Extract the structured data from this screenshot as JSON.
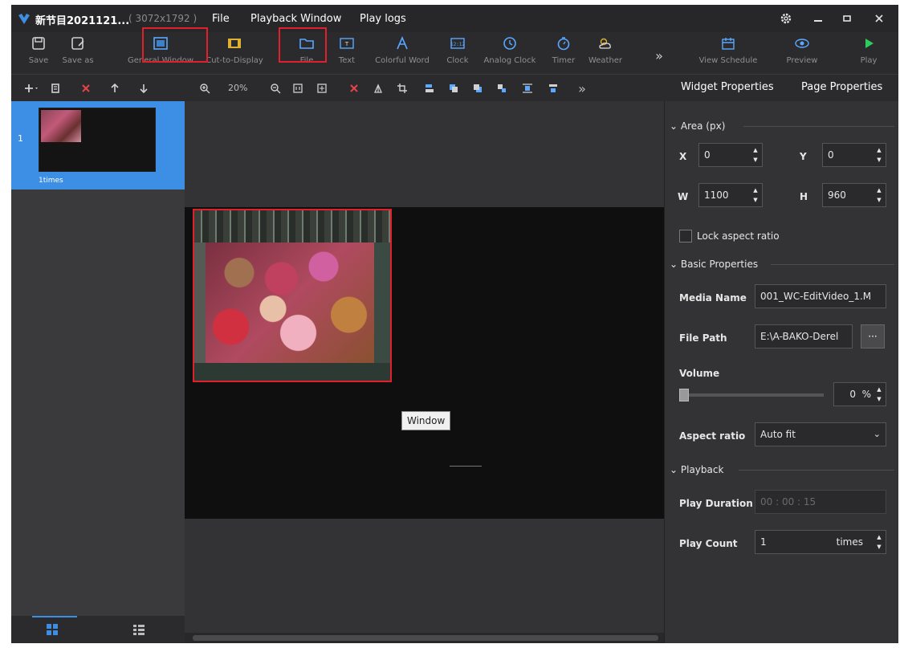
{
  "titlebar": {
    "project_name": "新节目2021121...",
    "project_resolution": "( 3072x1792 )",
    "menus": [
      "File",
      "Playback Window",
      "Play logs"
    ]
  },
  "toolbar": {
    "tools": [
      {
        "label": "Save",
        "icon": "save-icon"
      },
      {
        "label": "Save as",
        "icon": "save-as-icon"
      },
      {
        "label": "General Window",
        "icon": "window-icon"
      },
      {
        "label": "Cut-to-Display",
        "icon": "cut-to-display-icon"
      },
      {
        "label": "File",
        "icon": "folder-icon"
      },
      {
        "label": "Text",
        "icon": "text-icon"
      },
      {
        "label": "Colorful Word",
        "icon": "colorful-word-icon"
      },
      {
        "label": "Clock",
        "icon": "digital-clock-icon"
      },
      {
        "label": "Analog Clock",
        "icon": "analog-clock-icon"
      },
      {
        "label": "Timer",
        "icon": "timer-icon"
      },
      {
        "label": "Weather",
        "icon": "weather-icon"
      },
      {
        "label": "View Schedule",
        "icon": "calendar-icon"
      },
      {
        "label": "Preview",
        "icon": "eye-icon"
      },
      {
        "label": "Play",
        "icon": "play-icon"
      }
    ],
    "more": "»"
  },
  "subbar": {
    "zoom": "20%",
    "more": "»",
    "tabs": {
      "widget": "Widget Properties",
      "page": "Page Properties"
    }
  },
  "pages": {
    "items": [
      {
        "number": "1",
        "label": "1times"
      }
    ]
  },
  "canvas": {
    "tooltip": "Window"
  },
  "properties": {
    "area": {
      "title": "Area (px)",
      "x_label": "X",
      "x": "0",
      "y_label": "Y",
      "y": "0",
      "w_label": "W",
      "w": "1100",
      "h_label": "H",
      "h": "960",
      "lock_label": "Lock aspect ratio"
    },
    "basic": {
      "title": "Basic Properties",
      "media_name_label": "Media Name",
      "media_name": "001_WC-EditVideo_1.M",
      "file_path_label": "File Path",
      "file_path": "E:\\A-BAKO-Derel",
      "browse": "···",
      "volume_label": "Volume",
      "volume": "0",
      "volume_unit": "%",
      "aspect_label": "Aspect ratio",
      "aspect": "Auto fit"
    },
    "playback": {
      "title": "Playback",
      "duration_label": "Play Duration",
      "duration": "00 : 00 : 15",
      "count_label": "Play Count",
      "count": "1",
      "count_unit": "times"
    }
  },
  "colors": {
    "accent": "#3d8fe6",
    "highlight": "#e0202a",
    "background": "#2b2b2e"
  }
}
